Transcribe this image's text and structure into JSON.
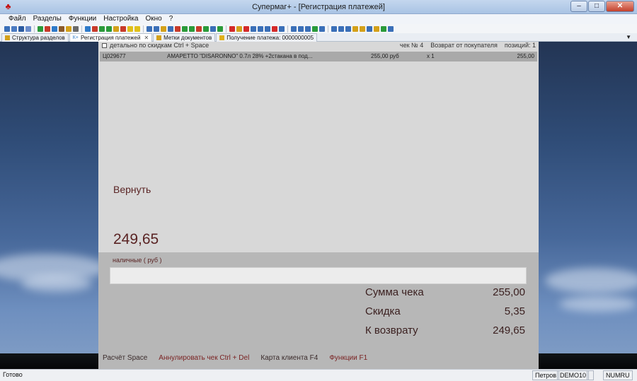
{
  "window": {
    "title": "Супермаг+  - [Регистрация платежей]",
    "controls": {
      "minimize": "–",
      "maximize": "□",
      "close": "✕"
    }
  },
  "menu": [
    "Файл",
    "Разделы",
    "Функции",
    "Настройка",
    "Окно",
    "?"
  ],
  "toolbar": {
    "groups": [
      [
        "#3a6fb8",
        "#4b7bc2",
        "#2b5aa0",
        "#6a8ccc"
      ],
      [
        "#2a9a3a",
        "#c83a2a",
        "#2e7ac9",
        "#8a5a2a",
        "#d4a11a",
        "#6a6a6a"
      ],
      [
        "#2e7ac9",
        "#c83a2a",
        "#2a9a3a",
        "#2a9a3a",
        "#d4a11a",
        "#c83a2a",
        "#e0c01a",
        "#e0c01a"
      ],
      [
        "#3a6fb8",
        "#3a6fb8",
        "#d4a11a",
        "#3a6fb8",
        "#c83a2a",
        "#2a9a3a",
        "#2a9a3a",
        "#c83a2a",
        "#2a9a3a",
        "#3a6fb8",
        "#2a9a3a"
      ],
      [
        "#d42a2a",
        "#d4a11a",
        "#d42a2a",
        "#3a6fb8",
        "#3a6fb8",
        "#3a6fb8",
        "#d42a2a",
        "#3a6fb8"
      ],
      [
        "#3a6fb8",
        "#3a6fb8",
        "#3a6fb8",
        "#2a9a3a",
        "#3a6fb8"
      ],
      [
        "#3a6fb8",
        "#3a6fb8",
        "#3a6fb8",
        "#d4a11a",
        "#d4a11a",
        "#3a6fb8",
        "#d4a11a",
        "#2a9a3a",
        "#3a6fb8"
      ]
    ]
  },
  "tabs": [
    {
      "label": "Структура разделов",
      "active": false,
      "icon_color": "#d4a11a"
    },
    {
      "label": "Регистрация платежей",
      "active": true,
      "icon_color": "#2e7ac9",
      "icon_text": "К+"
    },
    {
      "label": "Метки документов",
      "active": false,
      "icon_color": "#d4a11a"
    },
    {
      "label": "Получение платежа: 0000000005",
      "active": false,
      "icon_color": "#e0b01a"
    }
  ],
  "header": {
    "discount_toggle": "детально по скидкам Ctrl + Space",
    "receipt_no": "чек № 4",
    "operation": "Возврат от покупателя",
    "positions": "позиций: 1"
  },
  "item": {
    "code": "Ц029677",
    "name": "AMAPETTO \"DISARONNO\"  0.7л 28% +2стакана в под...",
    "price": "255,00 руб",
    "qty": "x 1",
    "sum": "255,00"
  },
  "action": {
    "label": "Вернуть",
    "amount": "249,65"
  },
  "payment": {
    "method_label": "наличные ( руб )",
    "input_value": ""
  },
  "totals": {
    "receipt_sum_label": "Сумма чека",
    "receipt_sum": "255,00",
    "discount_label": "Скидка",
    "discount": "5,35",
    "refund_label": "К возврату",
    "refund": "249,65"
  },
  "footer": {
    "calc": "Расчёт Space",
    "cancel": "Аннулировать чек Ctrl + Del",
    "client_card": "Карта клиента F4",
    "functions": "Функции F1"
  },
  "statusbar": {
    "ready": "Готово",
    "user": "Петров",
    "db": "DEMO10",
    "lock": "NUMRU"
  }
}
